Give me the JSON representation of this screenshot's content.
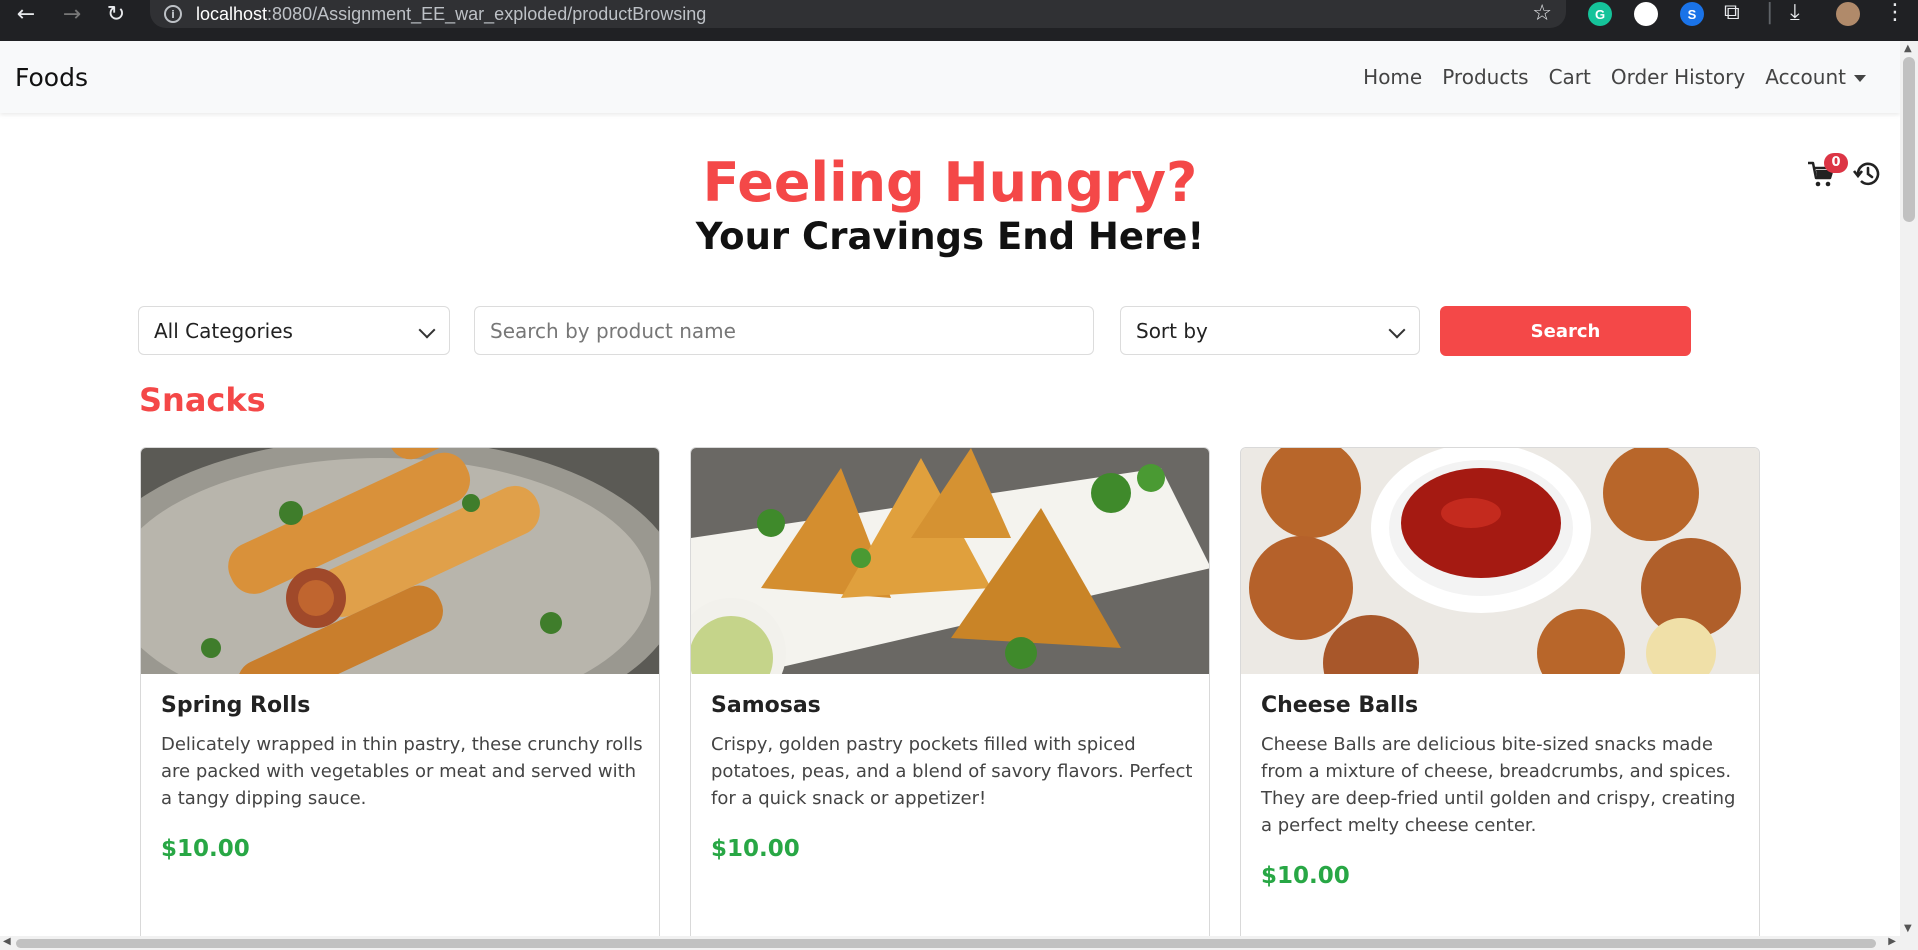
{
  "browser": {
    "url_host": "localhost",
    "url_rest": ":8080/Assignment_EE_war_exploded/productBrowsing"
  },
  "navbar": {
    "brand": "Foods",
    "links": [
      "Home",
      "Products",
      "Cart",
      "Order History",
      "Account"
    ]
  },
  "cart": {
    "count": "0"
  },
  "hero": {
    "title": "Feeling Hungry?",
    "subtitle": "Your Cravings End Here!"
  },
  "filters": {
    "category_selected": "All Categories",
    "search_placeholder": "Search by product name",
    "sort_selected": "Sort by",
    "search_button": "Search"
  },
  "section": {
    "title": "Snacks"
  },
  "products": [
    {
      "name": "Spring Rolls",
      "description": "Delicately wrapped in thin pastry, these crunchy rolls are packed with vegetables or meat and served with a tangy dipping sauce.",
      "price": "$10.00"
    },
    {
      "name": "Samosas",
      "description": "Crispy, golden pastry pockets filled with spiced potatoes, peas, and a blend of savory flavors. Perfect for a quick snack or appetizer!",
      "price": "$10.00"
    },
    {
      "name": "Cheese Balls",
      "description": "Cheese Balls are delicious bite-sized snacks made from a mixture of cheese, breadcrumbs, and spices. They are deep-fried until golden and crispy, creating a perfect melty cheese center.",
      "price": "$10.00"
    }
  ],
  "colors": {
    "accent": "#f44848",
    "price": "#28a745",
    "badge": "#dc3545"
  }
}
